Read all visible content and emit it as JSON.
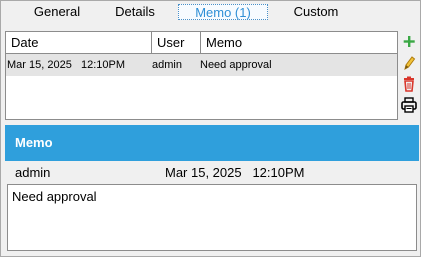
{
  "tabs": [
    {
      "label": "General"
    },
    {
      "label": "Details"
    },
    {
      "label": "Memo (1)",
      "active": true
    },
    {
      "label": "Custom"
    }
  ],
  "grid": {
    "columns": [
      "Date",
      "User",
      "Memo"
    ],
    "rows": [
      {
        "date": "Mar 15, 2025   12:10PM",
        "user": "admin",
        "memo": "Need approval",
        "selected": true
      }
    ]
  },
  "actions": [
    {
      "icon": "add-icon",
      "color": "#3aa845"
    },
    {
      "icon": "edit-pencil-icon",
      "color": "#e0a81e"
    },
    {
      "icon": "delete-trash-icon",
      "color": "#d9362b"
    },
    {
      "icon": "print-icon",
      "color": "#000000"
    }
  ],
  "memo_panel": {
    "title": "Memo",
    "user": "admin",
    "date": "Mar 15, 2025   12:10PM",
    "text": "Need approval"
  },
  "colors": {
    "accent": "#2f9fdc",
    "active_tab_text": "#2f8fd6",
    "selected_row": "#e4e4e4"
  }
}
